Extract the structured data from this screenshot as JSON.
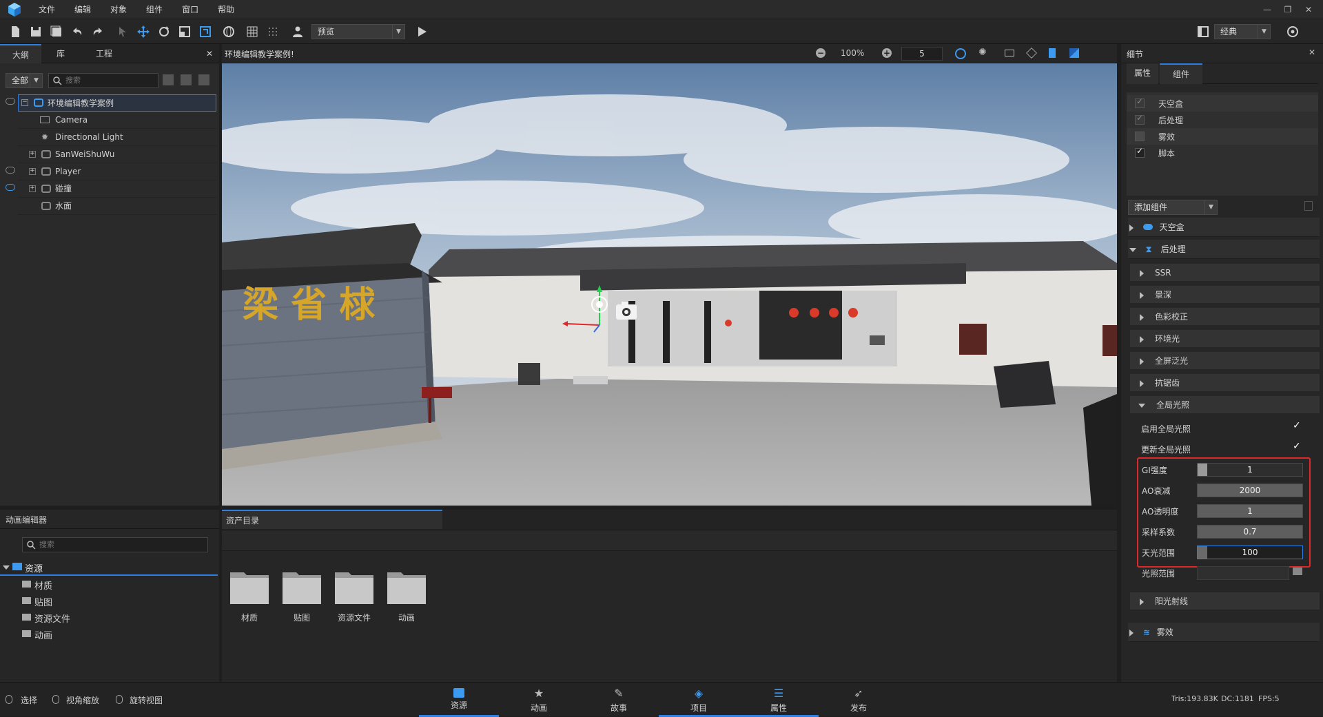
{
  "menu": {
    "items": [
      "文件",
      "编辑",
      "对象",
      "组件",
      "窗口",
      "帮助"
    ]
  },
  "toolbar": {
    "mode_select": "预览",
    "layout_select": "经典"
  },
  "left_panel": {
    "tabs": [
      "大纲",
      "库",
      "工程"
    ],
    "filter": "全部",
    "search_placeholder": "搜索",
    "tree": [
      {
        "label": "环境编辑教学案例",
        "selected": true
      },
      {
        "label": "Camera"
      },
      {
        "label": "Directional Light"
      },
      {
        "label": "SanWeiShuWu"
      },
      {
        "label": "Player"
      },
      {
        "label": "碰撞"
      },
      {
        "label": "水面"
      }
    ]
  },
  "viewport": {
    "title": "环境编辑教学案例!",
    "zoom": "100%",
    "speed": "5"
  },
  "anim_panel": {
    "title": "动画编辑器",
    "search_placeholder": "搜索",
    "root": "资源",
    "children": [
      "材质",
      "贴图",
      "资源文件",
      "动画"
    ]
  },
  "assets": {
    "tab": "资产目录",
    "folders": [
      "材质",
      "贴图",
      "资源文件",
      "动画"
    ]
  },
  "details": {
    "title": "细节",
    "tabs": [
      "属性",
      "组件"
    ],
    "components": [
      {
        "label": "天空盒",
        "checked": true
      },
      {
        "label": "后处理",
        "checked": true
      },
      {
        "label": "雾效",
        "checked": false
      },
      {
        "label": "脚本",
        "checked": true
      }
    ],
    "add_component": "添加组件",
    "sections": {
      "skybox": "天空盒",
      "postprocess": "后处理",
      "ssr": "SSR",
      "dof": "景深",
      "color": "色彩校正",
      "ambient": "环境光",
      "bloom": "全屏泛光",
      "aa": "抗锯齿",
      "gi": "全局光照",
      "sunrays": "阳光射线",
      "fog": "雾效"
    },
    "gi_props": {
      "enable_label": "启用全局光照",
      "update_label": "更新全局光照",
      "gi_strength_label": "GI强度",
      "gi_strength": "1",
      "ao_decay_label": "AO衰减",
      "ao_decay": "2000",
      "ao_opacity_label": "AO透明度",
      "ao_opacity": "1",
      "sample_label": "采样系数",
      "sample": "0.7",
      "sky_range_label": "天光范围",
      "sky_range": "100",
      "light_range_label": "光照范围"
    }
  },
  "statusbar": {
    "left": [
      "选择",
      "视角缩放",
      "旋转视图"
    ],
    "tabs": [
      "资源",
      "动画",
      "故事",
      "项目",
      "属性",
      "发布"
    ],
    "tris": "Tris:193.83K",
    "dc": "DC:1181",
    "fps": "FPS:5"
  },
  "scene": {
    "wall_text": "梁 省 梂"
  },
  "colors": {
    "accent": "#2f7fe3",
    "highlight": "#e0282a"
  }
}
